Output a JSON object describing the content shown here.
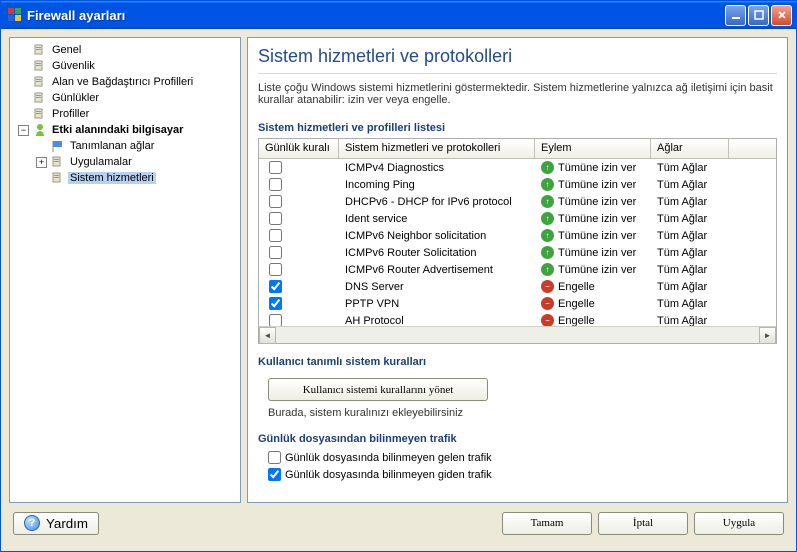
{
  "window": {
    "title": "Firewall ayarları"
  },
  "tree": {
    "items": [
      {
        "label": "Genel",
        "depth": 0,
        "expander": "none"
      },
      {
        "label": "Güvenlik",
        "depth": 0,
        "expander": "none"
      },
      {
        "label": "Alan ve Bağdaştırıcı Profilleri",
        "depth": 0,
        "expander": "none"
      },
      {
        "label": "Günlükler",
        "depth": 0,
        "expander": "none"
      },
      {
        "label": "Profiller",
        "depth": 0,
        "expander": "none"
      },
      {
        "label": "Etki alanındaki bilgisayar",
        "depth": 0,
        "expander": "minus",
        "bold": true,
        "iconColor": "#7bbf3a"
      },
      {
        "label": "Tanımlanan ağlar",
        "depth": 1,
        "expander": "none",
        "iconStyle": "blueFlag"
      },
      {
        "label": "Uygulamalar",
        "depth": 1,
        "expander": "plus"
      },
      {
        "label": "Sistem hizmetleri",
        "depth": 1,
        "expander": "none",
        "selected": true
      }
    ]
  },
  "content": {
    "title": "Sistem hizmetleri ve protokolleri",
    "description": "Liste çoğu Windows sistemi hizmetlerini göstermektedir. Sistem hizmetlerine yalnızca ağ iletişimi için basit kurallar atanabilir: izin ver veya engelle.",
    "list_heading": "Sistem hizmetleri ve profilleri listesi",
    "columns": {
      "rule": "Günlük kuralı",
      "service": "Sistem hizmetleri ve protokolleri",
      "action": "Eylem",
      "networks": "Ağlar"
    },
    "rows": [
      {
        "checked": false,
        "service": "ICMPv4 Diagnostics",
        "action": "allow",
        "action_label": "Tümüne izin ver",
        "networks": "Tüm Ağlar"
      },
      {
        "checked": false,
        "service": "Incoming Ping",
        "action": "allow",
        "action_label": "Tümüne izin ver",
        "networks": "Tüm Ağlar"
      },
      {
        "checked": false,
        "service": "DHCPv6 - DHCP for IPv6 protocol",
        "action": "allow",
        "action_label": "Tümüne izin ver",
        "networks": "Tüm Ağlar"
      },
      {
        "checked": false,
        "service": "Ident service",
        "action": "allow",
        "action_label": "Tümüne izin ver",
        "networks": "Tüm Ağlar"
      },
      {
        "checked": false,
        "service": "ICMPv6 Neighbor solicitation",
        "action": "allow",
        "action_label": "Tümüne izin ver",
        "networks": "Tüm Ağlar"
      },
      {
        "checked": false,
        "service": "ICMPv6 Router Solicitation",
        "action": "allow",
        "action_label": "Tümüne izin ver",
        "networks": "Tüm Ağlar"
      },
      {
        "checked": false,
        "service": "ICMPv6 Router Advertisement",
        "action": "allow",
        "action_label": "Tümüne izin ver",
        "networks": "Tüm Ağlar"
      },
      {
        "checked": true,
        "service": "DNS Server",
        "action": "deny",
        "action_label": "Engelle",
        "networks": "Tüm Ağlar"
      },
      {
        "checked": true,
        "service": "PPTP VPN",
        "action": "deny",
        "action_label": "Engelle",
        "networks": "Tüm Ağlar"
      },
      {
        "checked": false,
        "service": "AH Protocol",
        "action": "deny",
        "action_label": "Engelle",
        "networks": "Tüm Ağlar"
      }
    ],
    "user_rules_heading": "Kullanıcı tanımlı sistem kuralları",
    "manage_rules_btn": "Kullanıcı sistemi kurallarını yönet",
    "manage_rules_note": "Burada, sistem kuralınızı ekleyebilirsiniz",
    "unknown_traffic_heading": "Günlük dosyasından bilinmeyen trafik",
    "log_incoming": {
      "checked": false,
      "label": "Günlük dosyasında bilinmeyen gelen trafik"
    },
    "log_outgoing": {
      "checked": true,
      "label": "Günlük dosyasında bilinmeyen giden trafik"
    }
  },
  "footer": {
    "help": "Yardım",
    "ok": "Tamam",
    "cancel": "İptal",
    "apply": "Uygula"
  }
}
